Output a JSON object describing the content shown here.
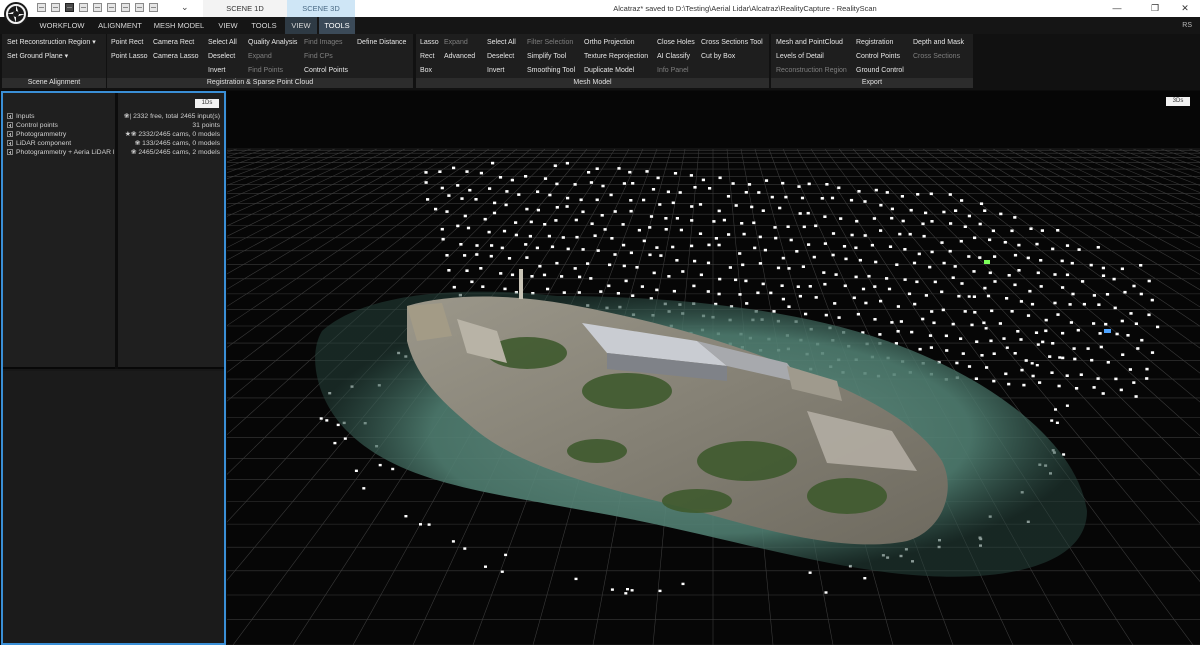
{
  "titlebar": {
    "scene_tabs": [
      "SCENE 1D",
      "SCENE 3D"
    ],
    "window_title": "Alcatraz* saved to D:\\Testing\\Aerial Lidar\\Alcatraz\\RealityCapture - RealityScan",
    "controls": {
      "minimize": "—",
      "maximize": "❐",
      "close": "✕"
    }
  },
  "menu": {
    "items": [
      "WORKFLOW",
      "ALIGNMENT",
      "MESH MODEL",
      "VIEW",
      "TOOLS",
      "VIEW",
      "TOOLS"
    ],
    "user_badge": "RS"
  },
  "ribbon": {
    "groups": [
      {
        "footer": "Scene Alignment",
        "buttons": [
          "Set Reconstruction Region ▾",
          "Set Ground Plane ▾"
        ]
      },
      {
        "footer": "Registration & Sparse Point Cloud",
        "buttons": [
          "Point Rect",
          "Point Lasso",
          "Camera Rect",
          "Camera Lasso",
          "Select All",
          "Deselect",
          "Invert",
          "Quality Analysis",
          "Expand",
          "Find Points",
          "Find Images",
          "Find CPs",
          "Control Points",
          "Define Distance"
        ]
      },
      {
        "footer": "Mesh Model",
        "buttons": [
          "Lasso",
          "Rect",
          "Box",
          "Expand",
          "Advanced",
          "Select All",
          "Deselect",
          "Invert",
          "Filter Selection",
          "Simplify Tool",
          "Smoothing Tool",
          "Ortho Projection",
          "Texture Reprojection",
          "Duplicate Model",
          "Close Holes",
          "AI Classify",
          "Info Panel",
          "Cross Sections Tool",
          "Cut by Box"
        ]
      },
      {
        "footer": "Export",
        "buttons": [
          "Mesh and PointCloud",
          "Levels of Detail",
          "Reconstruction Region",
          "Registration",
          "Control Points",
          "Ground Control",
          "Depth and Mask",
          "Cross Sections"
        ]
      }
    ]
  },
  "left_panel": {
    "badge": "1Ds",
    "tree": [
      {
        "label": "Inputs",
        "value": "❀| 2332 free, total 2465 input(s)"
      },
      {
        "label": "Control points",
        "value": "31 points"
      },
      {
        "label": "Photogrammetry",
        "value": "★❀  2332/2465 cams, 0 models"
      },
      {
        "label": "LiDAR component",
        "value": "❀      133/2465 cams, 0 models"
      },
      {
        "label": "Photogrammetry + Aeria LiDAR l",
        "value": "❀    2465/2465 cams, 2 models"
      }
    ]
  },
  "viewport": {
    "badge": "3Ds"
  },
  "colors": {
    "accent": "#3a8fd6",
    "water": "#5e8f80",
    "island_rock": "#8e8b80",
    "vegetation": "#3f5a2e"
  }
}
